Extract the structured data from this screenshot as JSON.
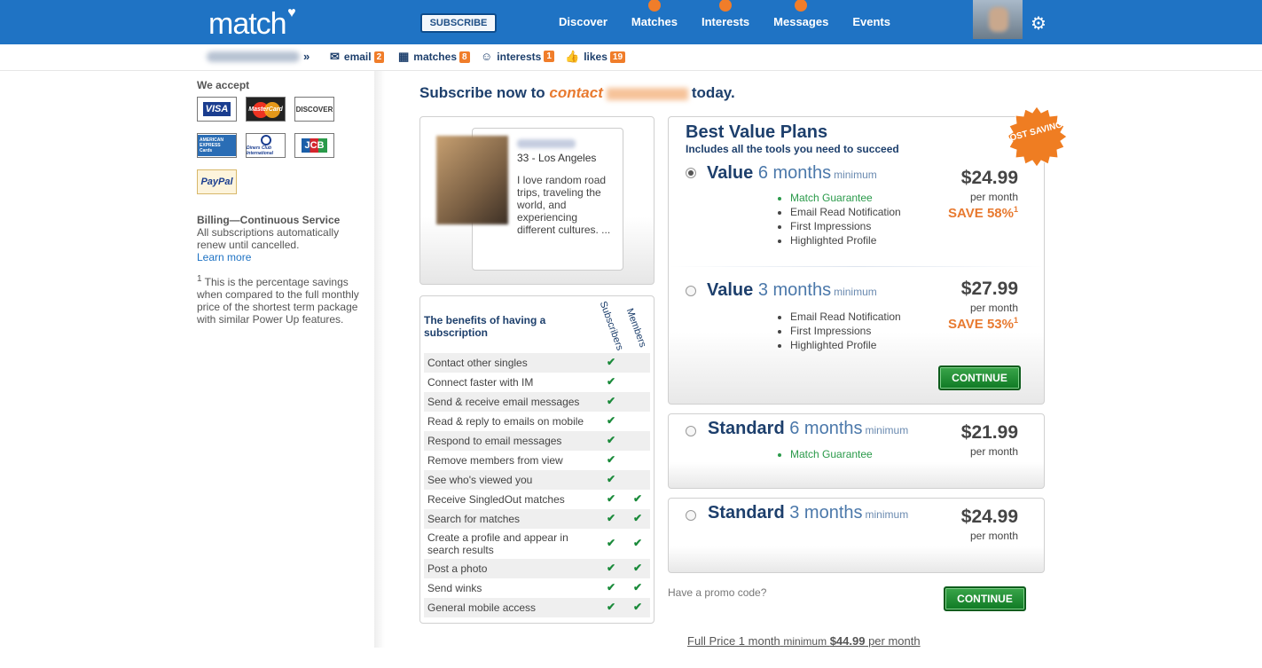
{
  "header": {
    "logo": "match",
    "subscribe": "SUBSCRIBE",
    "nav": [
      {
        "label": "Discover",
        "dot": false
      },
      {
        "label": "Matches",
        "dot": true
      },
      {
        "label": "Interests",
        "dot": true
      },
      {
        "label": "Messages",
        "dot": true
      },
      {
        "label": "Events",
        "dot": false
      }
    ]
  },
  "subbar": {
    "raquo": "»",
    "email": {
      "label": "email",
      "count": "2"
    },
    "matches": {
      "label": "matches",
      "count": "8"
    },
    "interests": {
      "label": "interests",
      "count": "1"
    },
    "likes": {
      "label": "likes",
      "count": "19"
    }
  },
  "left": {
    "accept": "We accept",
    "cards": {
      "visa": "VISA",
      "mastercard": "MasterCard",
      "discover": "DISCOVER",
      "amex": "AMERICAN EXPRESS Cards",
      "diners": "Diners Club International",
      "jcb": "JCB",
      "paypal": "PayPal"
    },
    "billing_title": "Billing—Continuous Service",
    "billing_text": "All subscriptions automatically renew until cancelled.",
    "learn_more": "Learn more",
    "footnote_mark": "1",
    "footnote": " This is the percentage savings when compared to the full monthly price of the shortest term package with similar Power Up features."
  },
  "main": {
    "headline_pre": "Subscribe now to",
    "headline_contact": "contact",
    "headline_post": "today."
  },
  "profile": {
    "location": "33 - Los Angeles",
    "bio": "I love random road trips, traveling the world, and experiencing different cultures. ..."
  },
  "benefits": {
    "title": "The benefits of having a subscription",
    "col_subscribers": "Subscribers",
    "col_members": "Members",
    "rows": [
      {
        "text": "Contact other singles",
        "sub": true,
        "mem": false
      },
      {
        "text": "Connect faster with IM",
        "sub": true,
        "mem": false
      },
      {
        "text": "Send & receive email messages",
        "sub": true,
        "mem": false
      },
      {
        "text": "Read & reply to emails on mobile",
        "sub": true,
        "mem": false
      },
      {
        "text": "Respond to email messages",
        "sub": true,
        "mem": false
      },
      {
        "text": "Remove members from view",
        "sub": true,
        "mem": false
      },
      {
        "text": "See who's viewed you",
        "sub": true,
        "mem": false
      },
      {
        "text": "Receive SingledOut matches",
        "sub": true,
        "mem": true
      },
      {
        "text": "Search for matches",
        "sub": true,
        "mem": true
      },
      {
        "text": "Create a profile and appear in search results",
        "sub": true,
        "mem": true
      },
      {
        "text": "Post a photo",
        "sub": true,
        "mem": true
      },
      {
        "text": "Send winks",
        "sub": true,
        "mem": true
      },
      {
        "text": "General mobile access",
        "sub": true,
        "mem": true
      }
    ]
  },
  "plans": {
    "best_title": "Best Value Plans",
    "best_sub": "Includes all the tools you need to succeed",
    "most_savings": "MOST SAVINGS",
    "value6": {
      "name": "Value",
      "duration": "6 months",
      "min": "minimum",
      "price": "$24.99",
      "per": "per month",
      "save": "SAVE 58%",
      "sup": "1",
      "features": [
        "Match Guarantee",
        "Email Read Notification",
        "First Impressions",
        "Highlighted Profile"
      ]
    },
    "value3": {
      "name": "Value",
      "duration": "3 months",
      "min": "minimum",
      "price": "$27.99",
      "per": "per month",
      "save": "SAVE 53%",
      "sup": "1",
      "features": [
        "Email Read Notification",
        "First Impressions",
        "Highlighted Profile"
      ]
    },
    "continue": "CONTINUE",
    "std6": {
      "name": "Standard",
      "duration": "6 months",
      "min": "minimum",
      "price": "$21.99",
      "per": "per month",
      "features": [
        "Match Guarantee"
      ]
    },
    "std3": {
      "name": "Standard",
      "duration": "3 months",
      "min": "minimum",
      "price": "$24.99",
      "per": "per month"
    },
    "promo": "Have a promo code?",
    "fullprice_pre": "Full Price 1 month",
    "fullprice_min": "minimum",
    "fullprice_price": "$44.99",
    "fullprice_post": "per month"
  },
  "colors": {
    "brand": "#1f73c4",
    "accent": "#f07d2a",
    "navy": "#1d3f6c",
    "green": "#1a8a3a"
  }
}
